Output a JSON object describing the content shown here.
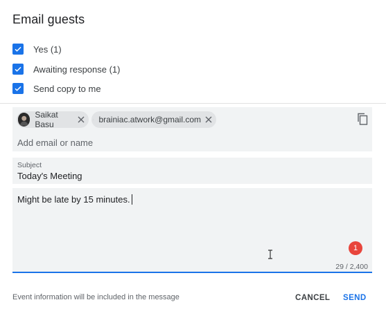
{
  "dialog": {
    "title": "Email guests"
  },
  "recipients_filters": [
    {
      "label": "Yes (1)",
      "checked": true
    },
    {
      "label": "Awaiting response (1)",
      "checked": true
    },
    {
      "label": "Send copy to me",
      "checked": true
    }
  ],
  "guests": {
    "chips": [
      {
        "label": "Saikat Basu",
        "avatar": "photo-avatar"
      },
      {
        "label": "brainiac.atwork@gmail.com",
        "avatar": "person-icon"
      }
    ],
    "add_placeholder": "Add email or name"
  },
  "subject": {
    "label": "Subject",
    "value": "Today's Meeting"
  },
  "message": {
    "body": "Might be late by 15 minutes.",
    "badge_count": "1",
    "char_counter": "29 / 2,400"
  },
  "footer": {
    "note": "Event information will be included in the message",
    "cancel_label": "CANCEL",
    "send_label": "SEND"
  },
  "colors": {
    "accent": "#1a73e8",
    "badge": "#e8453c",
    "panel": "#f1f3f4"
  }
}
